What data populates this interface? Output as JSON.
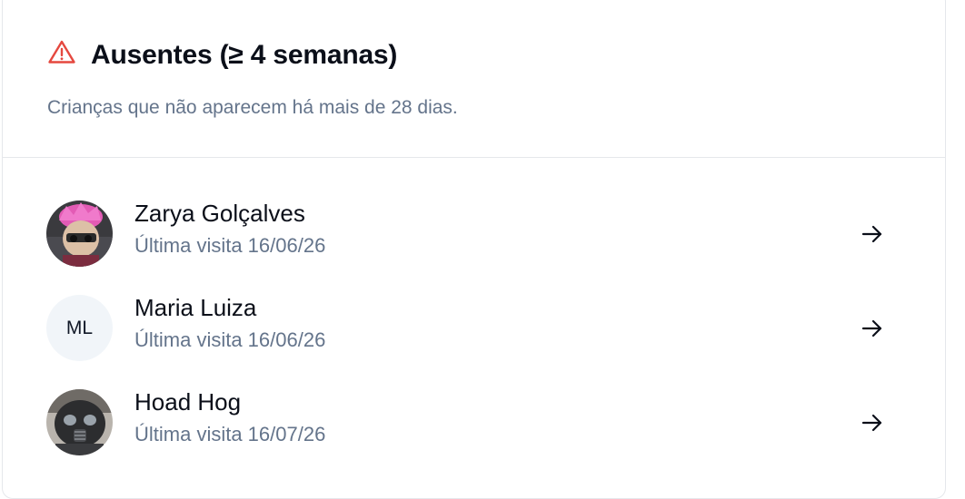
{
  "absent_card": {
    "title": "Ausentes (≥ 4 semanas)",
    "subtitle": "Crianças que não aparecem há mais de 28 dias.",
    "warning_icon": "alert-triangle-icon",
    "accent_color": "#e5483f",
    "children": [
      {
        "name": "Zarya Golçalves",
        "last_visit": "Última visita 16/06/26",
        "avatar": "photo-pink-hair-figure"
      },
      {
        "name": "Maria Luiza",
        "last_visit": "Última visita 16/06/26",
        "initials": "ML"
      },
      {
        "name": "Hoad Hog",
        "last_visit": "Última visita 16/07/26",
        "avatar": "photo-gas-mask-figure"
      }
    ],
    "row_action_icon": "arrow-right-icon"
  }
}
